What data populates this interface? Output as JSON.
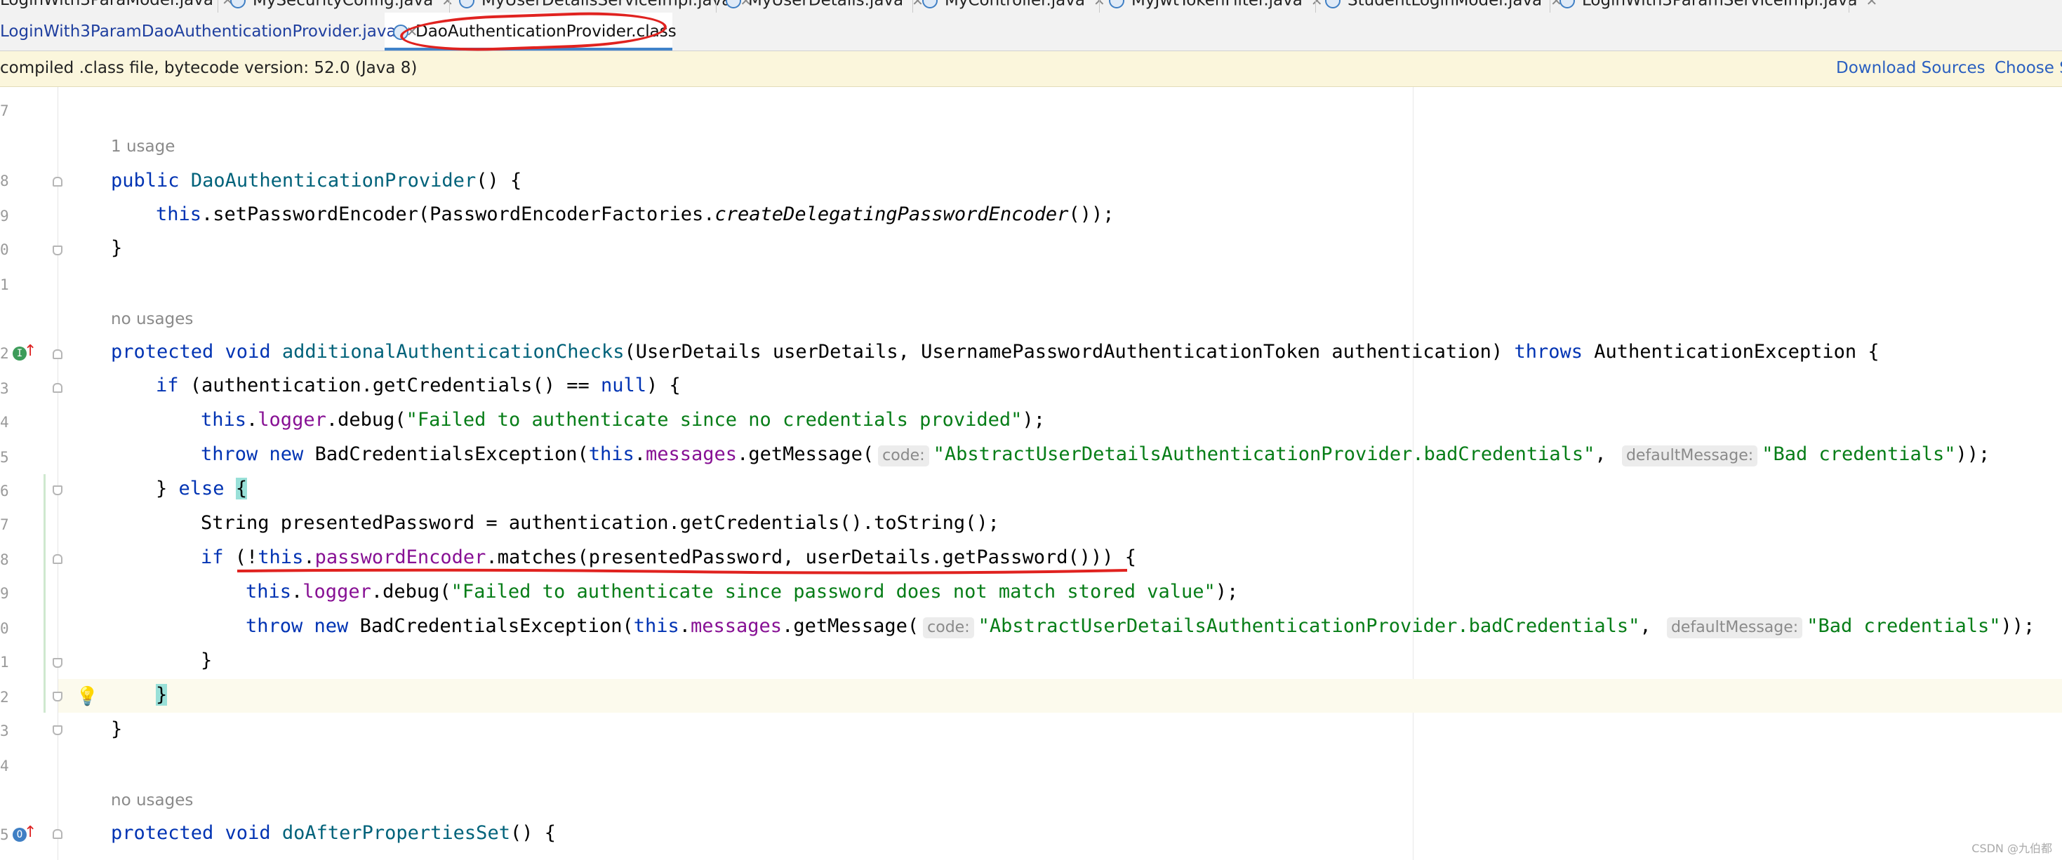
{
  "tabs_top": [
    {
      "label": "LoginWith3ParaModel.java"
    },
    {
      "label": "MySecurityConfig.java"
    },
    {
      "label": "MyUserDetailsServiceImpl.java"
    },
    {
      "label": "MyUserDetails.java"
    },
    {
      "label": "MyController.java"
    },
    {
      "label": "MyJwtTokenFilter.java"
    },
    {
      "label": "StudentLoginModel.java"
    },
    {
      "label": "LoginWith3ParamServiceImpl.java"
    }
  ],
  "tabs_bottom": [
    {
      "label": "LoginWith3ParamDaoAuthenticationProvider.java"
    },
    {
      "label": "DaoAuthenticationProvider.class"
    }
  ],
  "notice": {
    "text": "compiled .class file, bytecode version: 52.0 (Java 8)",
    "download_sources": "Download Sources",
    "choose_sources": "Choose Sources..."
  },
  "line_numbers": [
    "7",
    "8",
    "9",
    "0",
    "1",
    "2",
    "3",
    "4",
    "5",
    "6",
    "7",
    "8",
    "9",
    "0",
    "1",
    "2",
    "3",
    "4",
    "5"
  ],
  "usages": {
    "u1": "1 usage",
    "u2": "no usages",
    "u3": "no usages"
  },
  "code": {
    "l1_public": "public",
    "l1_name": "DaoAuthenticationProvider",
    "l1_rest": "() {",
    "l2_this": "this",
    "l2_a": ".setPasswordEncoder(PasswordEncoderFactories.",
    "l2_method": "createDelegatingPasswordEncoder",
    "l2_b": "());",
    "l3": "}",
    "l4_kw": "protected void",
    "l4_name": "additionalAuthenticationChecks",
    "l4_params": "(UserDetails userDetails, UsernamePasswordAuthenticationToken authentication)",
    "l4_throws": "throws",
    "l4_exc": "AuthenticationException {",
    "l5_if": "if",
    "l5_a": "(authentication.getCredentials() ==",
    "l5_null": "null",
    "l5_b": ") {",
    "l6_this": "this",
    "l6_dot": ".",
    "l6_field": "logger",
    "l6_a": ".debug(",
    "l6_str": "\"Failed to authenticate since no credentials provided\"",
    "l6_b": ");",
    "l7_throw": "throw new",
    "l7_a": "BadCredentialsException(",
    "l7_this": "this",
    "l7_dot": ".",
    "l7_field": "messages",
    "l7_b": ".getMessage(",
    "l7_hint1": "code:",
    "l7_str1": "\"AbstractUserDetailsAuthenticationProvider.badCredentials\"",
    "l7_comma": ",",
    "l7_hint2": "defaultMessage:",
    "l7_str2": "\"Bad credentials\"",
    "l7_c": "));",
    "l8_a": "}",
    "l8_else": "else",
    "l8_brace": "{",
    "l9": "String presentedPassword = authentication.getCredentials().toString();",
    "l10_if": "if",
    "l10_a": "(!",
    "l10_this": "this",
    "l10_dot": ".",
    "l10_field": "passwordEncoder",
    "l10_b": ".matches(presentedPassword, userDetails.getPassword())) {",
    "l11_this": "this",
    "l11_dot": ".",
    "l11_field": "logger",
    "l11_a": ".debug(",
    "l11_str": "\"Failed to authenticate since password does not match stored value\"",
    "l11_b": ");",
    "l12_throw": "throw new",
    "l12_a": "BadCredentialsException(",
    "l12_this": "this",
    "l12_dot": ".",
    "l12_field": "messages",
    "l12_b": ".getMessage(",
    "l12_hint1": "code:",
    "l12_str1": "\"AbstractUserDetailsAuthenticationProvider.badCredentials\"",
    "l12_comma": ",",
    "l12_hint2": "defaultMessage:",
    "l12_str2": "\"Bad credentials\"",
    "l12_c": "));",
    "l13": "}",
    "l14": "}",
    "l15": "}",
    "l16_kw": "protected void",
    "l16_name": "doAfterPropertiesSet",
    "l16_rest": "() {"
  },
  "watermark": "CSDN @九伯都",
  "colors": {
    "keyword": "#0033b3",
    "field": "#871094",
    "string": "#067d17",
    "method": "#00627a",
    "annotation_red": "#e0221f"
  }
}
